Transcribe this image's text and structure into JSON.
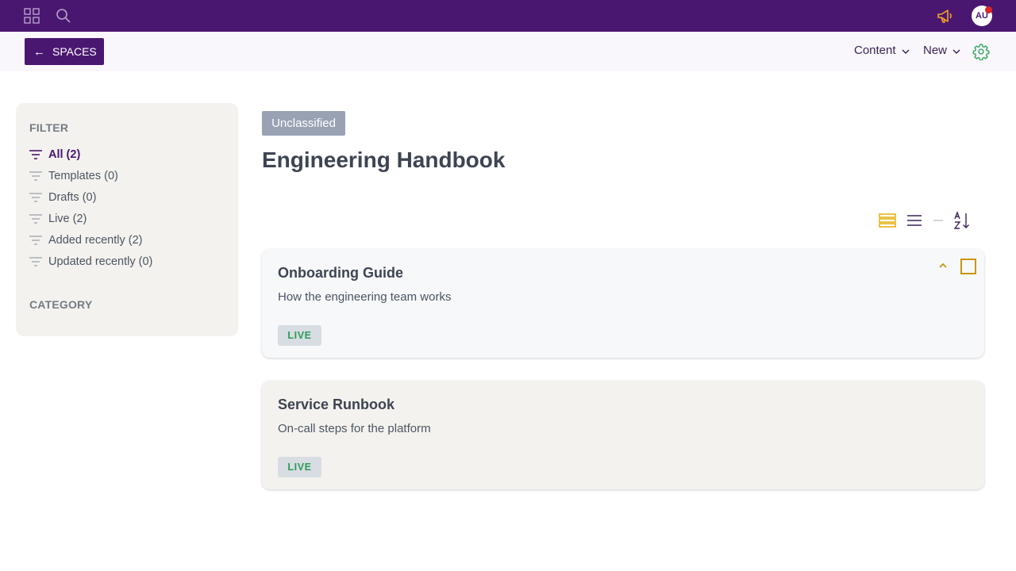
{
  "topbar": {
    "avatar_initials": "AU",
    "icons": [
      "grid-icon",
      "search-icon",
      "megaphone-icon",
      "avatar"
    ]
  },
  "subbar": {
    "back_label": "SPACES",
    "content_menu": "Content",
    "new_menu": "New"
  },
  "sidebar": {
    "filter_heading": "FILTER",
    "filters": [
      {
        "label": "All (2)",
        "active": true
      },
      {
        "label": "Templates (0)",
        "active": false
      },
      {
        "label": "Drafts (0)",
        "active": false
      },
      {
        "label": "Live (2)",
        "active": false
      },
      {
        "label": "Added recently (2)",
        "active": false
      },
      {
        "label": "Updated recently (0)",
        "active": false
      }
    ],
    "category_heading": "CATEGORY"
  },
  "main": {
    "classification": "Unclassified",
    "title": "Engineering Handbook",
    "cards": [
      {
        "title": "Onboarding Guide",
        "description": "How the engineering team works",
        "status": "LIVE"
      },
      {
        "title": "Service Runbook",
        "description": "On-call steps for the platform",
        "status": "LIVE"
      }
    ]
  },
  "colors": {
    "brand": "#4a1770",
    "accent": "#c9960c",
    "live_text": "#2e9a58",
    "gear": "#3aa864"
  }
}
